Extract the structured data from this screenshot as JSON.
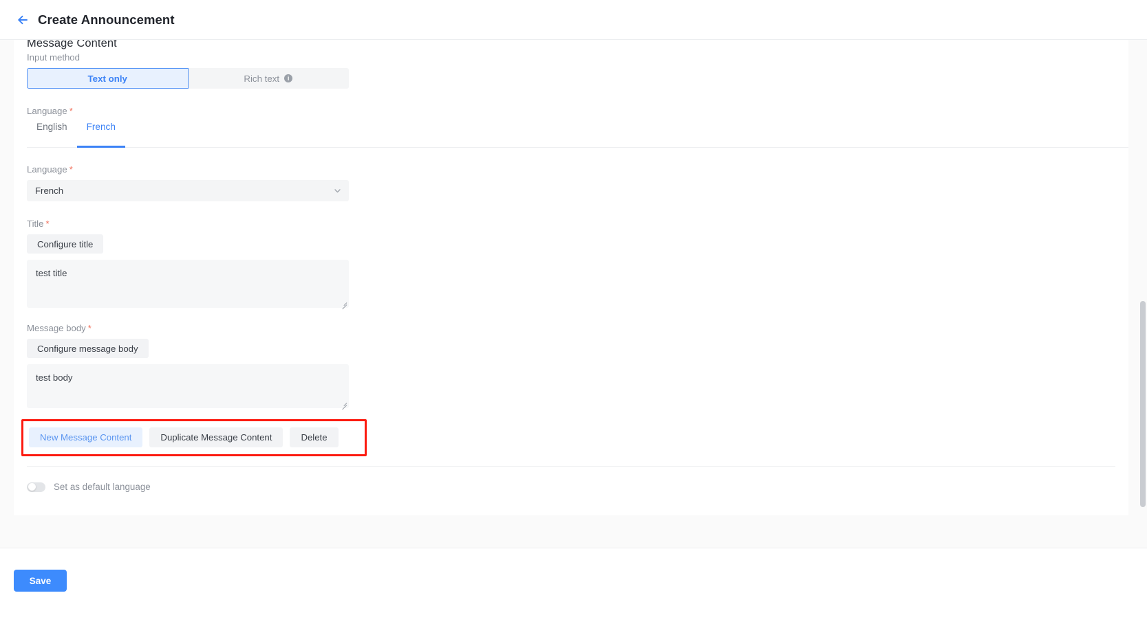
{
  "header": {
    "back_icon": "arrow-left-icon",
    "title": "Create Announcement"
  },
  "section": {
    "heading": "Message Content"
  },
  "input_method": {
    "label": "Input method",
    "options": [
      {
        "label": "Text only",
        "selected": true
      },
      {
        "label": "Rich text",
        "selected": false,
        "info_icon": "info-icon"
      }
    ]
  },
  "language_tabs": {
    "label": "Language",
    "required": "*",
    "tabs": [
      {
        "label": "English",
        "active": false
      },
      {
        "label": "French",
        "active": true
      }
    ]
  },
  "language_select": {
    "label": "Language",
    "required": "*",
    "value": "French",
    "chevron_icon": "chevron-down-icon"
  },
  "title_field": {
    "label": "Title",
    "required": "*",
    "configure_button": "Configure title",
    "value": "test title"
  },
  "message_body_field": {
    "label": "Message body",
    "required": "*",
    "configure_button": "Configure message body",
    "value": "test body"
  },
  "action_row": {
    "highlight_color": "#fc1b10",
    "buttons": [
      {
        "label": "New Message Content",
        "style": "primary"
      },
      {
        "label": "Duplicate Message Content",
        "style": "default"
      },
      {
        "label": "Delete",
        "style": "default"
      }
    ]
  },
  "default_language_toggle": {
    "label": "Set as default language",
    "state": "off"
  },
  "footer": {
    "save_label": "Save",
    "save_color": "#3d8bfd"
  }
}
